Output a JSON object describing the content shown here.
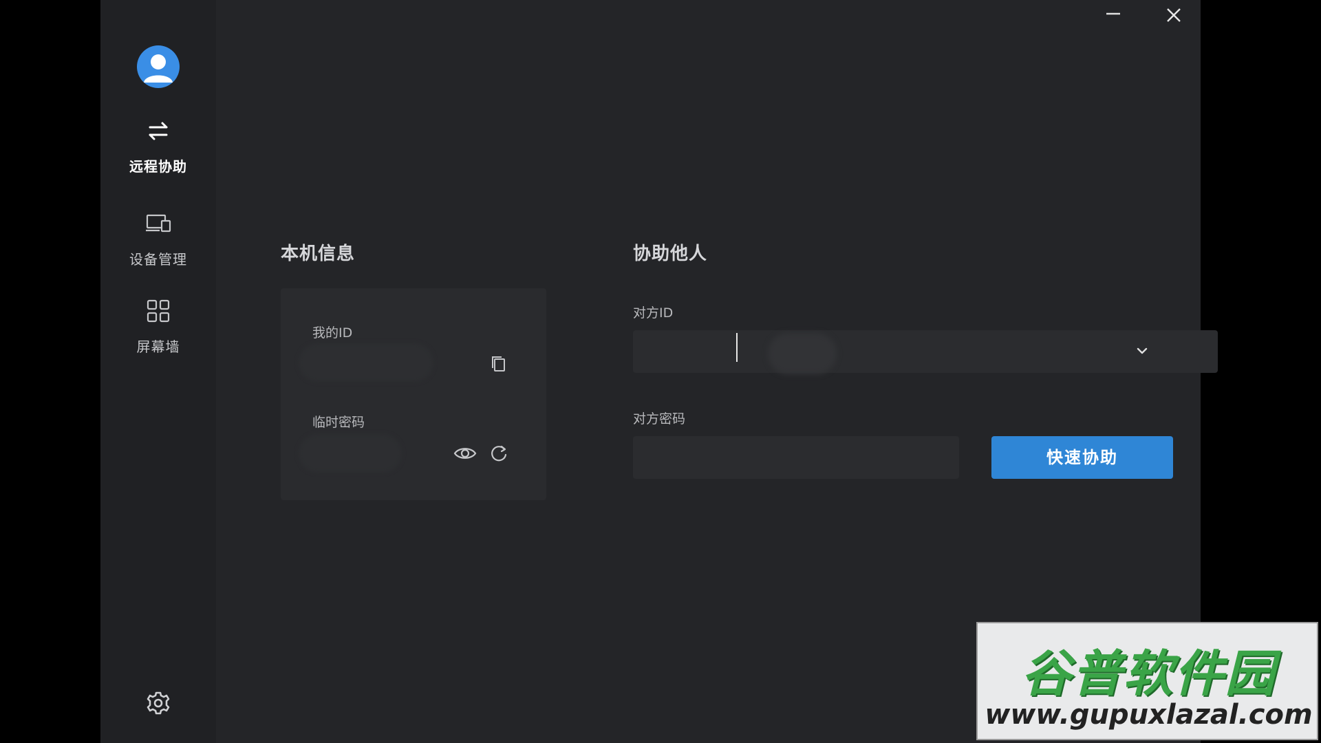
{
  "sidebar": {
    "items": [
      {
        "label": "远程协助",
        "icon": "swap-arrows-icon",
        "active": true
      },
      {
        "label": "设备管理",
        "icon": "devices-icon",
        "active": false
      },
      {
        "label": "屏幕墙",
        "icon": "grid-icon",
        "active": false
      }
    ],
    "settings_icon": "gear-icon",
    "avatar_icon": "user-avatar-icon"
  },
  "window_controls": {
    "minimize_icon": "minimize-icon",
    "close_icon": "close-icon"
  },
  "local_info": {
    "title": "本机信息",
    "my_id_label": "我的ID",
    "temp_password_label": "临时密码"
  },
  "assist_others": {
    "title": "协助他人",
    "peer_id_label": "对方ID",
    "peer_id_value": "",
    "peer_password_label": "对方密码",
    "peer_password_value": "",
    "connect_button": "快速协助"
  },
  "watermark": {
    "cn": "谷普软件园",
    "en": "www.gupuxlazal.com"
  },
  "colors": {
    "accent": "#2f86d6",
    "background": "#242528",
    "sidebar": "#202124",
    "card": "#2a2b2e"
  }
}
